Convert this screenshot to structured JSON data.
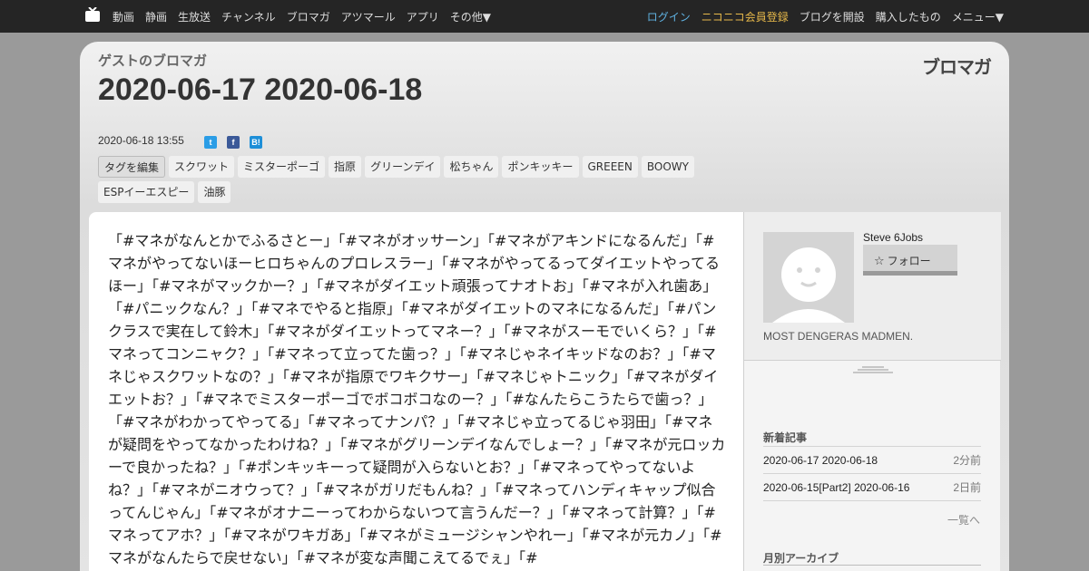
{
  "topbar": {
    "nav": [
      "動画",
      "静画",
      "生放送",
      "チャンネル",
      "ブロマガ",
      "アツマール",
      "アプリ",
      "その他▼"
    ],
    "right": {
      "login": "ログイン",
      "register": "ニコニコ会員登録",
      "open_blog": "ブログを開設",
      "purchased": "購入したもの",
      "menu": "メニュー▼"
    }
  },
  "header": {
    "blog_name": "ゲストのブロマガ",
    "brand": "ブロマガ",
    "title": "2020-06-17 2020-06-18",
    "posted_at": "2020-06-18 13:55"
  },
  "share": {
    "twitter": "t",
    "facebook": "f",
    "hatena": "B!"
  },
  "tags": {
    "edit_label": "タグを編集",
    "items": [
      "スクワット",
      "ミスターポーゴ",
      "指原",
      "グリーンデイ",
      "松ちゃん",
      "ポンキッキー",
      "GREEEN",
      "BOOWY",
      "ESPイーエスピー",
      "油豚"
    ]
  },
  "article": {
    "body": "「#マネがなんとかでふるさとー」「#マネがオッサーン」「#マネがアキンドになるんだ」「#マネがやってないほーヒロちゃんのプロレスラー」「#マネがやってるってダイエットやってるほー」「#マネがマックかー？」「#マネがダイエット頑張ってナオトお」「#マネが入れ歯あ」「#パニックなん？」「#マネでやると指原」「#マネがダイエットのマネになるんだ」「#パンクラスで実在して鈴木」「#マネがダイエットってマネー？」「#マネがスーモでいくら？」「#マネってコンニャク？」「#マネって立ってた歯っ？」「#マネじゃネイキッドなのお？」「#マネじゃスクワットなの？」「#マネが指原でワキクサー」「#マネじゃトニック」「#マネがダイエットお？」「#マネでミスターポーゴでボコボコなのー？」「#なんたらこうたらで歯っ？」「#マネがわかってやってる」「#マネってナンパ？」「#マネじゃ立ってるじゃ羽田」「#マネが疑問をやってなかったわけね？」「#マネがグリーンデイなんでしょー？」「#マネが元ロッカーで良かったね？」「#ポンキッキーって疑問が入らないとお？」「#マネってやってないよね？」「#マネがニオウって？」「#マネがガリだもんね？」「#マネってハンディキャップ似合ってんじゃん」「#マネがオナニーってわからないつて言うんだー？」「#マネって計算？」「#マネってアホ？」「#マネがワキガあ」「#マネがミュージシャンやれー」「#マネが元カノ」「#マネがなんたらで戻せない」「#マネが変な声聞こえてるでぇ」「#"
  },
  "sidebar": {
    "username": "Steve 6Jobs",
    "follow_label": "フォロー",
    "tagline": "MOST DENGERAS MADMEN.",
    "recent_title": "新着記事",
    "recent": [
      {
        "title": "2020-06-17 2020-06-18",
        "ago": "2分前"
      },
      {
        "title": "2020-06-15[Part2] 2020-06-16",
        "ago": "2日前"
      }
    ],
    "more_label": "一覧へ",
    "archive_title": "月別アーカイブ"
  },
  "colors": {
    "topbar_bg": "#252525",
    "login": "#5fb1e0",
    "register": "#e6b84a",
    "page_bg": "#9a9a9a"
  }
}
